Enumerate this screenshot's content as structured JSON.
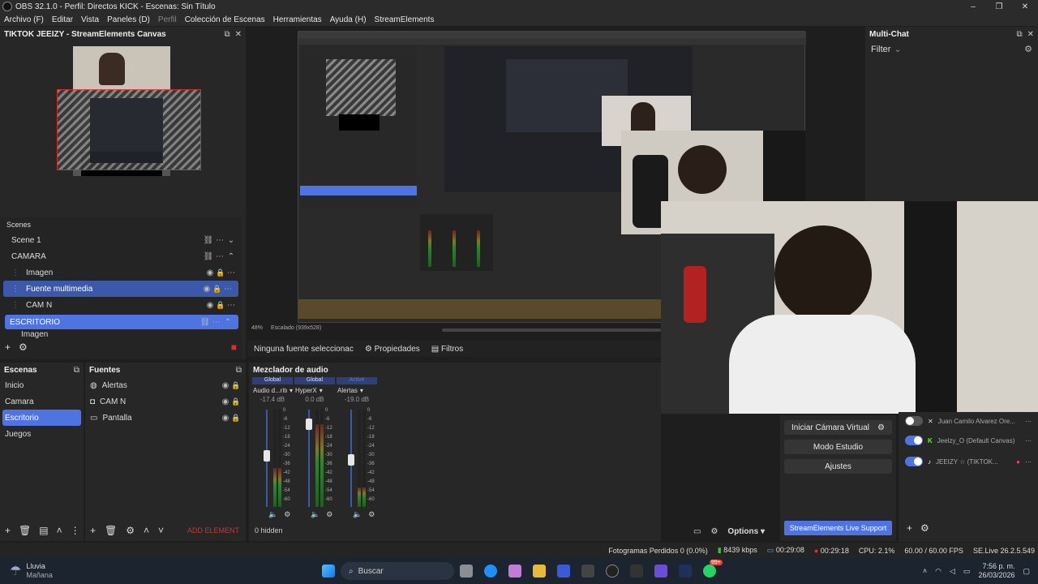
{
  "window": {
    "title": "OBS 32.1.0 - Perfil: Directos KICK - Escenas: Sin Título",
    "controls": [
      "–",
      "❐",
      "✕"
    ]
  },
  "menu": [
    "Archivo (F)",
    "Editar",
    "Vista",
    "Paneles (D)",
    "Perfil",
    "Colección de Escenas",
    "Herramientas",
    "Ayuda (H)",
    "StreamElements"
  ],
  "canvas_dock": {
    "title": "TIKTOK JEEIZY - StreamElements Canvas"
  },
  "scenes_tree": {
    "header": "Scenes",
    "items": [
      {
        "label": "Scene 1",
        "kind": "scene"
      },
      {
        "label": "CAMARA",
        "kind": "group"
      },
      {
        "label": "Imagen",
        "kind": "source"
      },
      {
        "label": "Fuente multimedia",
        "kind": "source-selected"
      },
      {
        "label": "CAM N",
        "kind": "source"
      },
      {
        "label": "ESCRITORIO",
        "kind": "group-selected"
      },
      {
        "label": "Imagen",
        "kind": "source-cut"
      }
    ]
  },
  "escenas": {
    "title": "Escenas",
    "items": [
      "Inicio",
      "Camara",
      "Escritorio",
      "Juegos"
    ],
    "selected": "Escritorio"
  },
  "fuentes": {
    "title": "Fuentes",
    "items": [
      {
        "label": "Alertas",
        "icon": "globe-icon"
      },
      {
        "label": "CAM N",
        "icon": "camera-icon"
      },
      {
        "label": "Pantalla",
        "icon": "monitor-icon"
      }
    ],
    "add_element": "ADD ELEMENT"
  },
  "preview": {
    "zoom": "48%",
    "scale": "Escalado (939x528)"
  },
  "props_bar": {
    "no_source": "Ninguna fuente seleccionac",
    "properties": "Propiedades",
    "filters": "Filtros"
  },
  "mixer": {
    "title": "Mezclador de audio",
    "channels": [
      {
        "badge": "Global",
        "name": "Audio d...ritorio",
        "db": "-17.4 dB",
        "level": 0.4,
        "fader": 0.55
      },
      {
        "badge": "Global",
        "name": "HyperX",
        "db": "0.0 dB",
        "level": 0.85,
        "fader": 0.9
      },
      {
        "badge": "Active",
        "name": "Alertas",
        "db": "-19.0 dB",
        "level": 0.2,
        "fader": 0.5
      }
    ],
    "scale": [
      "0",
      "-6",
      "-12",
      "-18",
      "-24",
      "-30",
      "-36",
      "-42",
      "-48",
      "-54",
      "-60"
    ],
    "hidden": "0 hidden",
    "options": "Options"
  },
  "controls": {
    "virtual_cam": "Iniciar Cámara Virtual",
    "studio": "Modo Estudio",
    "settings": "Ajustes",
    "support": "StreamElements Live Support"
  },
  "multichat": {
    "title": "Multi-Chat",
    "filter": "Filter"
  },
  "outputs": [
    {
      "label": "Juan Camilo Alvarez Ore...",
      "on": false
    },
    {
      "label": "Jeelzy_O (Default Canvas)",
      "on": true
    },
    {
      "label": "JEEIZY ☆ (TIKTOK...",
      "on": true
    }
  ],
  "statusbar": {
    "dropped": "Fotogramas Perdidos 0 (0.0%)",
    "kbps": "8439 kbps",
    "rec1": "00:29:08",
    "rec2": "00:29:18",
    "cpu": "CPU: 2.1%",
    "fps": "60.00 / 60.00 FPS",
    "se": "SE.Live 26.2.5.549"
  },
  "taskbar": {
    "weather": "Lluvia",
    "weather_sub": "Mañana",
    "search": "Buscar",
    "badge": "99+",
    "time": "7:56 p. m.",
    "date": "26/03/2026"
  },
  "colors": {
    "accent": "#4f73e0",
    "selected": "#3c58a8",
    "panel": "#272727",
    "bg": "#1f1e1f"
  }
}
